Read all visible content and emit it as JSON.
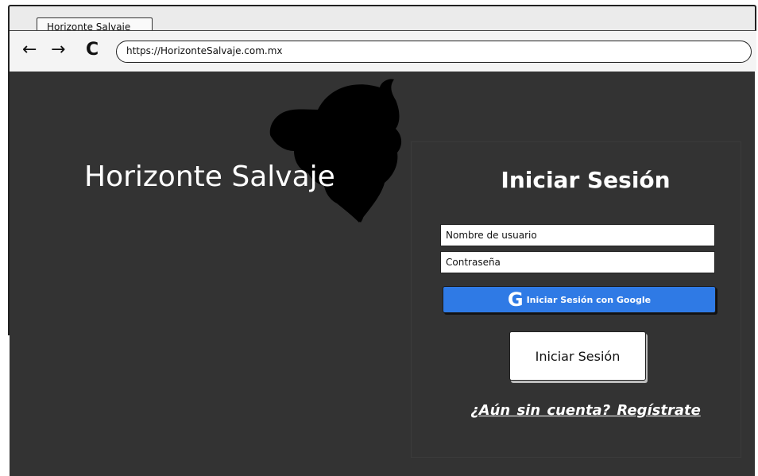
{
  "browser": {
    "tab_title": "Horizonte Salvaje",
    "url": "https://HorizonteSalvaje.com.mx",
    "back_glyph": "←",
    "forward_glyph": "→",
    "reload_glyph": "C"
  },
  "brand": {
    "name": "Horizonte Salvaje",
    "logo_icon": "lion-head-icon"
  },
  "login": {
    "title": "Iniciar Sesión",
    "username_placeholder": "Nombre de usuario",
    "password_placeholder": "Contraseña",
    "google_icon_glyph": "G",
    "google_label": "Iniciar Sesión con Google",
    "submit_label": "Iniciar Sesión",
    "signup_link": "¿Aún sin cuenta?  Regístrate"
  },
  "colors": {
    "page_background": "#333333",
    "google_button": "#2f7ae5",
    "text_light": "#ffffff"
  }
}
